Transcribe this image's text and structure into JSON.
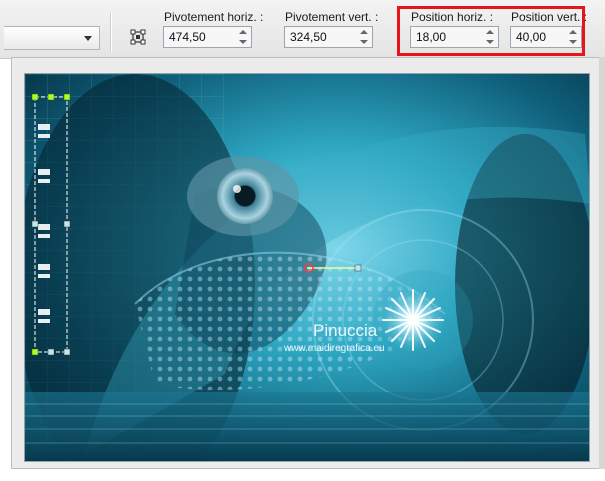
{
  "toolbar": {
    "pivot_h": {
      "label": "Pivotement horiz. :",
      "value": "474,50"
    },
    "pivot_v": {
      "label": "Pivotement vert. :",
      "value": "324,50"
    },
    "pos_h": {
      "label": "Position horiz. :",
      "value": "18,00"
    },
    "pos_v": {
      "label": "Position vert. :",
      "value": "40,00"
    }
  },
  "canvas": {
    "watermark_name": "Pinuccia",
    "watermark_url": "www.maidiregrafica.eu"
  },
  "colors": {
    "highlight": "#e8141b",
    "teal": "#2fa8c3"
  },
  "icons": [
    "dropdown-arrow-icon",
    "pick-tool-icon",
    "spin-up-icon",
    "spin-down-icon"
  ]
}
